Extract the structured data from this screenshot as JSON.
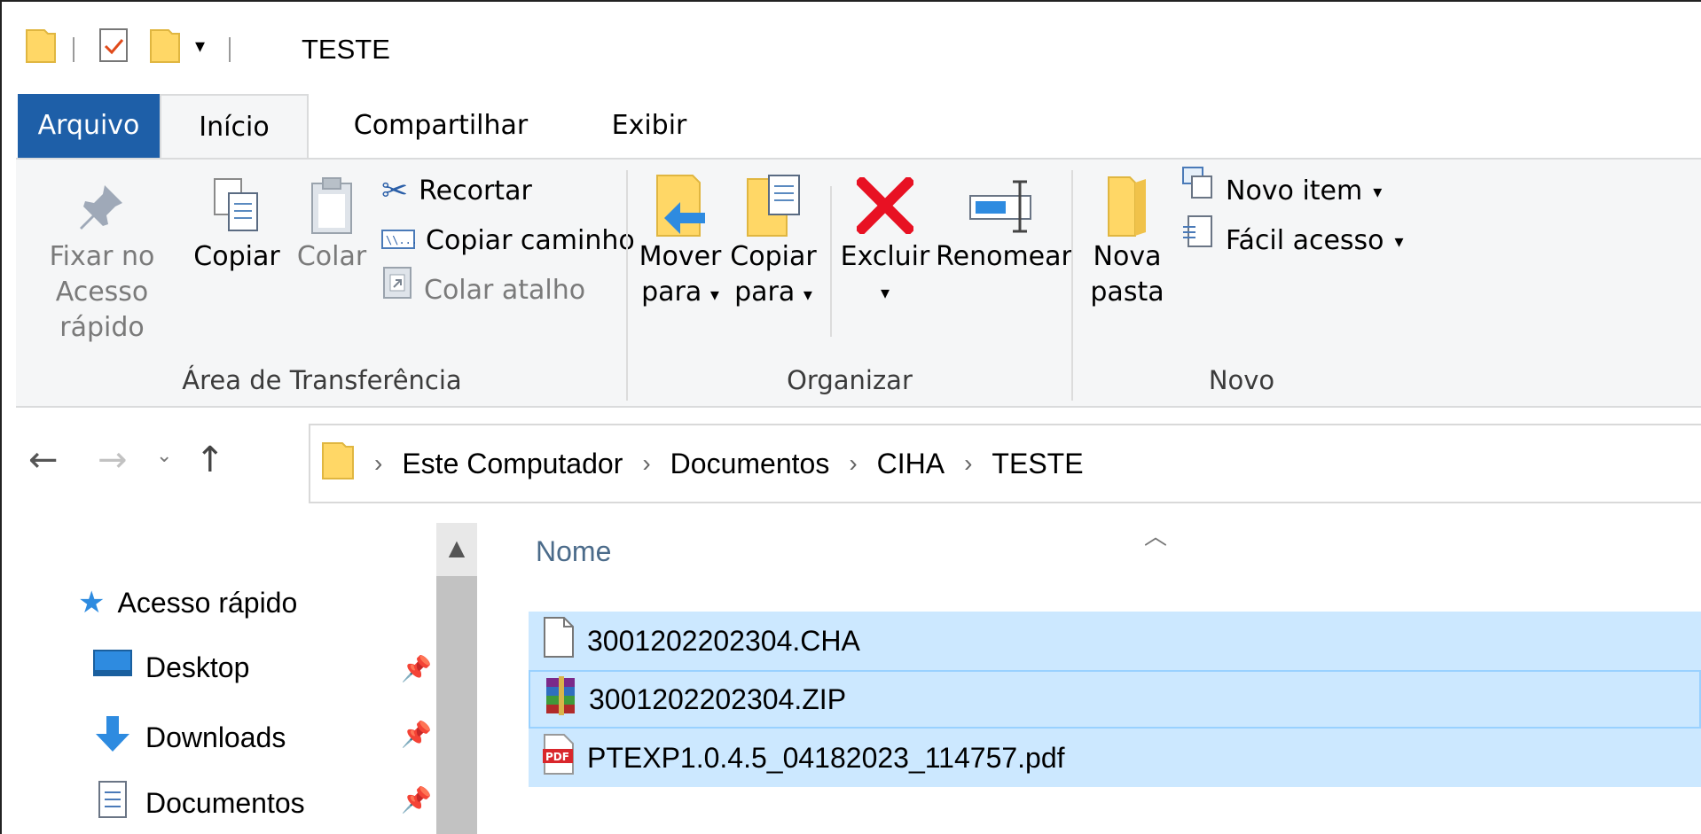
{
  "window": {
    "title": "TESTE"
  },
  "tabs": [
    {
      "label": "Arquivo"
    },
    {
      "label": "Início"
    },
    {
      "label": "Compartilhar"
    },
    {
      "label": "Exibir"
    }
  ],
  "ribbon": {
    "clipboard": {
      "pin_label_1": "Fixar no",
      "pin_label_2": "Acesso rápido",
      "copy_label": "Copiar",
      "paste_label": "Colar",
      "cut_label": "Recortar",
      "copy_path_label": "Copiar caminho",
      "paste_shortcut_label": "Colar atalho",
      "group_label": "Área de Transferência"
    },
    "organize": {
      "move_label_1": "Mover",
      "move_label_2": "para",
      "copyto_label_1": "Copiar",
      "copyto_label_2": "para",
      "delete_label": "Excluir",
      "rename_label": "Renomear",
      "group_label": "Organizar"
    },
    "new": {
      "new_folder_label_1": "Nova",
      "new_folder_label_2": "pasta",
      "new_item_label": "Novo item",
      "easy_access_label": "Fácil acesso",
      "group_label": "Novo"
    }
  },
  "address": {
    "crumbs": [
      "Este Computador",
      "Documentos",
      "CIHA",
      "TESTE"
    ]
  },
  "sidebar": {
    "items": [
      {
        "label": "Acesso rápido",
        "icon": "star-icon"
      },
      {
        "label": "Desktop",
        "icon": "desktop-icon"
      },
      {
        "label": "Downloads",
        "icon": "download-icon"
      },
      {
        "label": "Documentos",
        "icon": "document-icon"
      }
    ]
  },
  "files": {
    "column_name": "Nome",
    "rows": [
      {
        "name": "3001202202304.CHA",
        "icon": "file-icon"
      },
      {
        "name": "3001202202304.ZIP",
        "icon": "winrar-archive-icon"
      },
      {
        "name": "PTEXP1.0.4.5_04182023_114757.pdf",
        "icon": "pdf-icon"
      }
    ]
  },
  "colors": {
    "file_tab": "#1e5fa8",
    "selection": "#cce8ff",
    "folder": "#ffd766",
    "delete_red": "#e81123"
  }
}
